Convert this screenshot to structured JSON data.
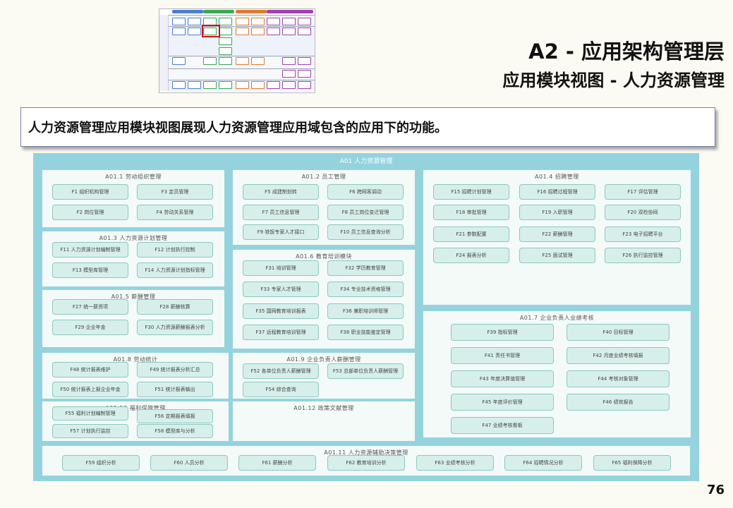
{
  "header": {
    "title_main": "A2 - 应用架构管理层",
    "title_sub": "应用模块视图 - 人力资源管理"
  },
  "description": "人力资源管理应用模块视图展现人力资源管理应用域包含的应用下的功能。",
  "domain": {
    "title": "A01 人力资源管理",
    "modules": [
      {
        "id": "A01.1",
        "title": "A01.1 劳动组织管理",
        "functions": [
          "F1 组织机构管理",
          "F3 定员管理",
          "F2 岗位管理",
          "F4 劳动关系管理"
        ]
      },
      {
        "id": "A01.2",
        "title": "A01.2 员工管理",
        "functions": [
          "F5 成建制划转",
          "F6 跨网客调动",
          "F7 员工信息管理",
          "F8 员工岗位变迁管理",
          "F9 铁饭专家人才接口",
          "F10 员工信息查询分析"
        ]
      },
      {
        "id": "A01.3",
        "title": "A01.3 人力资源计划管理",
        "functions": [
          "F11 人力资源计划编制管理",
          "F12 计划执行控制",
          "F13 模型库管理",
          "F14 人力资源计划指标管理"
        ]
      },
      {
        "id": "A01.4",
        "title": "A01.4 招聘管理",
        "functions": [
          "F15 招聘计划管理",
          "F16 招聘过程管理",
          "F17 评估管理",
          "F18 审批管理",
          "F19 入职管理",
          "F20 双检协同",
          "F21 参数配置",
          "F22 薪酬管理",
          "F23 电子招聘平台",
          "F24 报表分析",
          "F25 面试管理",
          "F26 执行监控管理"
        ]
      },
      {
        "id": "A01.5",
        "title": "A01.5 薪酬管理",
        "functions": [
          "F27 统一薪资项",
          "F28 薪酬核算",
          "F29 企业年金",
          "F30 人力资源薪酬报表分析"
        ]
      },
      {
        "id": "A01.6",
        "title": "A01.6 教育培训模块",
        "functions": [
          "F31 培训管理",
          "F32 学历教育管理",
          "F33 专家人才管理",
          "F34 专业技术资格管理",
          "F35 国网教育培训报表",
          "F36 兼职培训师管理",
          "F37 远程教育培训管理",
          "F38 职业技能鉴定管理"
        ]
      },
      {
        "id": "A01.7",
        "title": "A01.7 企业负责人业绩考核",
        "functions": [
          "F39 指标管理",
          "F40 目标管理",
          "F41 责任书管理",
          "F42 月度业绩考核填报",
          "F43 年度决算值管理",
          "F44 考核对象管理",
          "F45 年度评价管理",
          "F46 绩效报告",
          "F47 业绩考核看板"
        ]
      },
      {
        "id": "A01.8",
        "title": "A01.8 劳动统计",
        "functions": [
          "F48 统计报表维护",
          "F49 统计报表分析汇总",
          "F50 统计报表上报企业年金",
          "F51 统计报表输出"
        ]
      },
      {
        "id": "A01.9",
        "title": "A01.9 企业负责人薪酬管理",
        "functions": [
          "F52 各单位负责人薪酬管理",
          "F53 总部单位负责人薪酬管理",
          "F54 综合查询"
        ]
      },
      {
        "id": "A01.10",
        "title": "A01.10 福利保障管理",
        "functions": [
          "F55 福利计划编制管理",
          "F56 定期报表填报",
          "F57 计划执行监控",
          "F58 模型库与分析"
        ]
      },
      {
        "id": "A01.12",
        "title": "A01.12 政策文献管理",
        "functions": []
      },
      {
        "id": "A01.11",
        "title": "A01.11 人力资源辅助决策管理",
        "functions": [
          "F59 组织分析",
          "F60 人员分析",
          "F61 薪酬分析",
          "F62 教育培训分析",
          "F63 业绩考核分析",
          "F64 招聘情况分析",
          "F65 福利保障分析"
        ]
      }
    ]
  },
  "page_number": "76",
  "thumbnail": {
    "colors": {
      "green": "#3aa655",
      "blue": "#4a7fd0",
      "orange": "#e07a2e",
      "purple": "#a040b0",
      "red": "#d11111"
    }
  }
}
